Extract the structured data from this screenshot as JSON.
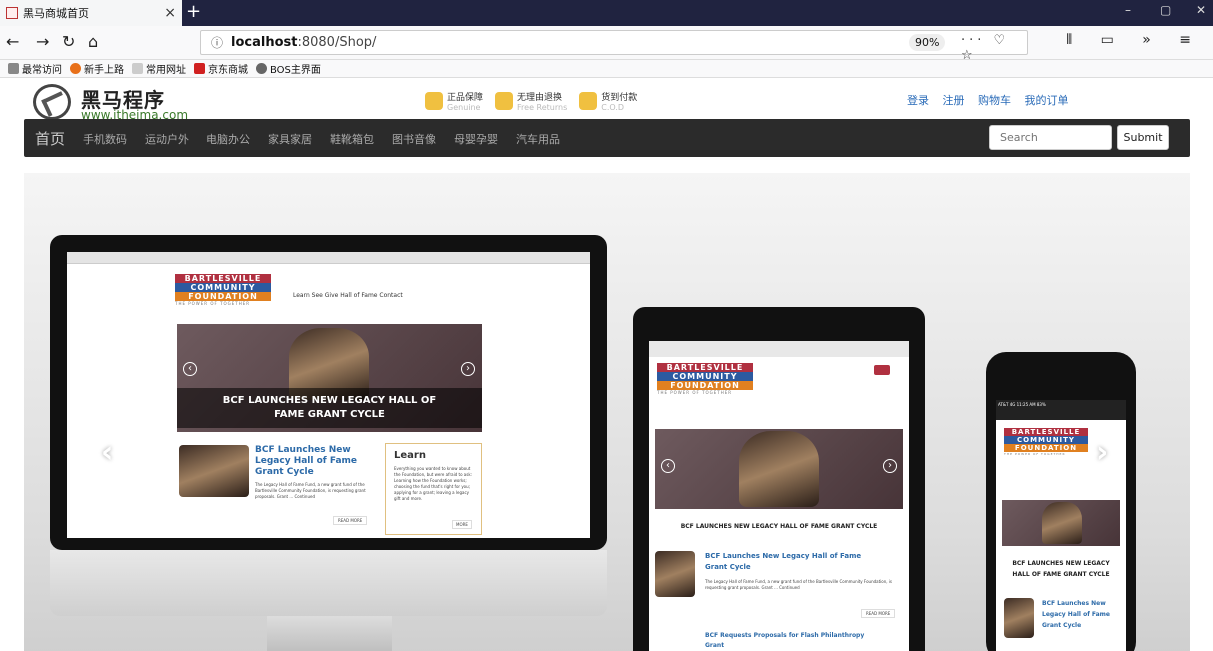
{
  "browser": {
    "tab_title": "黑马商城首页",
    "tab_close": "×",
    "new_tab": "+",
    "win_min": "–",
    "win_max": "▢",
    "win_close": "✕",
    "zoom": "90%",
    "url_host": "localhost",
    "url_path": ":8080/Shop/",
    "url_info_icon": "ⓘ",
    "url_actions": "··· ♡ ☆",
    "right_tools": "⫴ ▭ »  ≡",
    "bookmarks": [
      "最常访问",
      "新手上路",
      "常用网址",
      "京东商城",
      "BOS主界面"
    ]
  },
  "site": {
    "brand_name": "黑马程序员",
    "brand_url": "www.itheima.com",
    "badges": [
      {
        "title": "正品保障",
        "sub": "Genuine"
      },
      {
        "title": "无理由退换",
        "sub": "Free Returns"
      },
      {
        "title": "货到付款",
        "sub": "C.O.D"
      }
    ],
    "toplinks": [
      "登录",
      "注册",
      "购物车",
      "我的订单"
    ],
    "nav_home": "首页",
    "nav_items": [
      "手机数码",
      "运动户外",
      "电脑办公",
      "家具家居",
      "鞋靴箱包",
      "图书音像",
      "母婴孕婴",
      "汽车用品"
    ],
    "search_placeholder": "Search",
    "submit_label": "Submit"
  },
  "carousel": {
    "prev": "‹",
    "next": "›",
    "monitor": {
      "logo1": "BARTLESVILLE",
      "logo2": "COMMUNITY",
      "logo3": "FOUNDATION",
      "tagline": "THE POWER OF TOGETHER",
      "links": "Learn   See   Give   Hall of Fame   Contact",
      "headline": "BCF LAUNCHES NEW LEGACY HALL OF FAME GRANT CYCLE",
      "story_title": "BCF Launches New Legacy Hall of Fame Grant Cycle",
      "story_body": "The Legacy Hall of Fame Fund, a new grant fund of the Bartlesville Community Foundation, is requesting grant proposals. Grant ... Continued",
      "learn_title": "Learn",
      "learn_body": "Everything you wanted to know about the Foundation, but were afraid to ask: Learning how the Foundation works; choosing the fund that's right for you; applying for a grant; leaving a legacy gift and more.",
      "read_more": "READ MORE",
      "more": "MORE"
    },
    "tablet": {
      "headline": "BCF LAUNCHES NEW LEGACY HALL OF FAME GRANT CYCLE",
      "story_title": "BCF Launches New Legacy Hall of Fame Grant Cycle",
      "story_body": "The Legacy Hall of Fame Fund, a new grant fund of the Bartlesville Community Foundation, is requesting grant proposals. Grant ... Continued",
      "read_more": "READ MORE",
      "story2": "BCF Requests Proposals for Flash Philanthropy Grant"
    },
    "phone": {
      "status": "AT&T 4G  11:25 AM  83%",
      "headline": "BCF LAUNCHES NEW LEGACY HALL OF FAME GRANT CYCLE",
      "story_title": "BCF Launches New Legacy Hall of Fame Grant Cycle"
    }
  }
}
